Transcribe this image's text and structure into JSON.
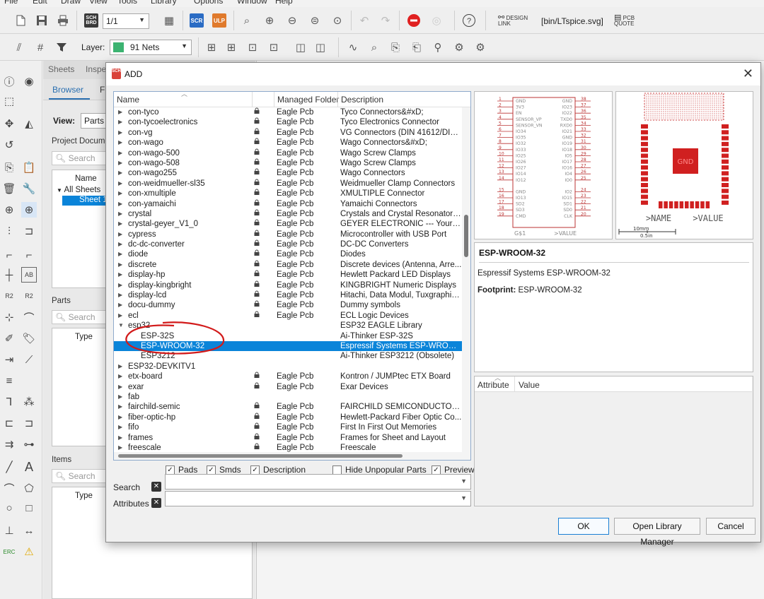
{
  "menubar": [
    "File",
    "Edit",
    "Draw",
    "View",
    "Tools",
    "Library",
    "Options",
    "Window",
    "Help"
  ],
  "toolbar1": {
    "sheet_value": "1/1",
    "scr_label": "SCR",
    "ulp_label": "ULP",
    "design_link": "DESIGN LINK",
    "script_path": "[bin/LTspice.svg]",
    "pcb_quote": "PCB QUOTE"
  },
  "toolbar2": {
    "layer_label": "Layer:",
    "layer_value": "91 Nets",
    "layer_color": "#3cb371"
  },
  "sidepanel": {
    "tabs": [
      "Sheets",
      "Inspe"
    ],
    "subtabs": [
      "Browser",
      "F"
    ],
    "view_label": "View:",
    "view_value": "Parts",
    "project_docs": "Project Docume",
    "search_placeholder": "Search",
    "name_header": "Name",
    "all_sheets": "All Sheets",
    "sheet_item": "Sheet 1",
    "parts_label": "Parts",
    "parts_search": "Search",
    "type_header": "Type",
    "items_label": "Items",
    "items_search": "Search",
    "items_type_header": "Type"
  },
  "dialog": {
    "title": "ADD",
    "columns": {
      "name": "Name",
      "folder": "Managed Folder",
      "description": "Description"
    },
    "rows": [
      {
        "name": "con-tyco",
        "folder": "Eagle Pcb",
        "desc": "Tyco Connectors&#xD;",
        "lock": true
      },
      {
        "name": "con-tycoelectronics",
        "folder": "Eagle Pcb",
        "desc": "Tyco Electronics Connector",
        "lock": true
      },
      {
        "name": "con-vg",
        "folder": "Eagle Pcb",
        "desc": "VG Connectors (DIN 41612/DIN ...",
        "lock": true
      },
      {
        "name": "con-wago",
        "folder": "Eagle Pcb",
        "desc": "Wago Connectors&#xD;",
        "lock": true
      },
      {
        "name": "con-wago-500",
        "folder": "Eagle Pcb",
        "desc": "Wago Screw Clamps",
        "lock": true
      },
      {
        "name": "con-wago-508",
        "folder": "Eagle Pcb",
        "desc": "Wago Screw Clamps",
        "lock": true
      },
      {
        "name": "con-wago255",
        "folder": "Eagle Pcb",
        "desc": "Wago Connectors",
        "lock": true
      },
      {
        "name": "con-weidmueller-sl35",
        "folder": "Eagle Pcb",
        "desc": "Weidmueller Clamp Connectors",
        "lock": true
      },
      {
        "name": "con-xmultiple",
        "folder": "Eagle Pcb",
        "desc": "XMULTIPLE Connector",
        "lock": true
      },
      {
        "name": "con-yamaichi",
        "folder": "Eagle Pcb",
        "desc": "Yamaichi Connectors",
        "lock": true
      },
      {
        "name": "crystal",
        "folder": "Eagle Pcb",
        "desc": "Crystals and Crystal Resonators&...",
        "lock": true
      },
      {
        "name": "crystal-geyer_V1_0",
        "folder": "Eagle Pcb",
        "desc": "GEYER ELECTRONIC --- Your pro...",
        "lock": true
      },
      {
        "name": "cypress",
        "folder": "Eagle Pcb",
        "desc": "Microcontroller with USB Port",
        "lock": true
      },
      {
        "name": "dc-dc-converter",
        "folder": "Eagle Pcb",
        "desc": "DC-DC Converters",
        "lock": true
      },
      {
        "name": "diode",
        "folder": "Eagle Pcb",
        "desc": "Diodes",
        "lock": true
      },
      {
        "name": "discrete",
        "folder": "Eagle Pcb",
        "desc": "Discrete devices (Antenna, Arre...",
        "lock": true
      },
      {
        "name": "display-hp",
        "folder": "Eagle Pcb",
        "desc": "Hewlett Packard LED Displays",
        "lock": true
      },
      {
        "name": "display-kingbright",
        "folder": "Eagle Pcb",
        "desc": "KINGBRIGHT Numeric Displays",
        "lock": true
      },
      {
        "name": "display-lcd",
        "folder": "Eagle Pcb",
        "desc": "Hitachi, Data Modul, Tuxgraphics...",
        "lock": true
      },
      {
        "name": "docu-dummy",
        "folder": "Eagle Pcb",
        "desc": "Dummy symbols",
        "lock": true
      },
      {
        "name": "ecl",
        "folder": "Eagle Pcb",
        "desc": "ECL Logic Devices",
        "lock": true
      },
      {
        "name": "esp32",
        "folder": "",
        "desc": "ESP32 EAGLE Library",
        "lock": false,
        "expanded": true
      },
      {
        "name": "ESP-32S",
        "folder": "",
        "desc": "Ai-Thinker ESP-32S",
        "lock": false,
        "child": true
      },
      {
        "name": "ESP-WROOM-32",
        "folder": "",
        "desc": "Espressif Systems ESP-WROOM-32",
        "lock": false,
        "child": true,
        "selected": true
      },
      {
        "name": "ESP3212",
        "folder": "",
        "desc": "Ai-Thinker ESP3212 (Obsolete)",
        "lock": false,
        "child": true
      },
      {
        "name": "ESP32-DEVKITV1",
        "folder": "",
        "desc": "",
        "lock": false
      },
      {
        "name": "etx-board",
        "folder": "Eagle Pcb",
        "desc": "Kontron / JUMPtec ETX Board",
        "lock": true
      },
      {
        "name": "exar",
        "folder": "Eagle Pcb",
        "desc": "Exar Devices",
        "lock": true
      },
      {
        "name": "fab",
        "folder": "",
        "desc": "",
        "lock": false
      },
      {
        "name": "fairchild-semic",
        "folder": "Eagle Pcb",
        "desc": "FAIRCHILD SEMICONDUCTOR In...",
        "lock": true
      },
      {
        "name": "fiber-optic-hp",
        "folder": "Eagle Pcb",
        "desc": "Hewlett-Packard Fiber Optic Co...",
        "lock": true
      },
      {
        "name": "fifo",
        "folder": "Eagle Pcb",
        "desc": "First In First Out Memories",
        "lock": true
      },
      {
        "name": "frames",
        "folder": "Eagle Pcb",
        "desc": "Frames for Sheet and Layout",
        "lock": true
      },
      {
        "name": "freescale",
        "folder": "Eagle Pcb",
        "desc": "Freescale",
        "lock": true
      }
    ],
    "checkboxes": [
      {
        "label": "Pads",
        "checked": true
      },
      {
        "label": "Smds",
        "checked": true
      },
      {
        "label": "Description",
        "checked": true
      },
      {
        "label": "Hide Unpopular Parts",
        "checked": false
      },
      {
        "label": "Preview",
        "checked": true
      }
    ],
    "search_label": "Search",
    "attributes_label": "Attributes",
    "info": {
      "title": "ESP-WROOM-32",
      "description": "Espressif Systems ESP-WROOM-32",
      "footprint_label": "Footprint:",
      "footprint_value": "ESP-WROOM-32"
    },
    "attr_columns": {
      "attribute": "Attribute",
      "value": "Value"
    },
    "symbol_preview": {
      "left_pins": [
        "GND",
        "3V3",
        "EN",
        "SENSOR_VP",
        "SENSOR_VN",
        "IO34",
        "IO35",
        "IO32",
        "IO33",
        "IO25",
        "IO26",
        "IO27",
        "IO14",
        "IO12",
        "GND",
        "IO13",
        "SD2",
        "SD3",
        "CMD"
      ],
      "right_pins": [
        "GND",
        "IO23",
        "IO22",
        "TXD0",
        "RXD0",
        "IO21",
        "GND",
        "IO19",
        "IO18",
        "IO5",
        "IO17",
        "IO16",
        "IO4",
        "IO0",
        "IO2",
        "IO15",
        "SD1",
        "SD0",
        "CLK"
      ],
      "left_nums": [
        "1",
        "2",
        "3",
        "4",
        "5",
        "6",
        "7",
        "8",
        "9",
        "10",
        "11",
        "12",
        "13",
        "14",
        "15",
        "16",
        "17",
        "18",
        "19"
      ],
      "right_nums": [
        "38",
        "37",
        "36",
        "35",
        "34",
        "33",
        "32",
        "31",
        "30",
        "29",
        "28",
        "27",
        "26",
        "25",
        "24",
        "23",
        "22",
        "21",
        "20"
      ],
      "name_label": "G$1",
      "value_label": ">VALUE"
    },
    "package_preview": {
      "center_label": "GND",
      "name_label": ">NAME",
      "value_label": ">VALUE",
      "scale_mm": "10mm",
      "scale_in": "0.5in"
    },
    "buttons": {
      "ok": "OK",
      "open_library_manager": "Open Library Manager",
      "cancel": "Cancel"
    }
  }
}
